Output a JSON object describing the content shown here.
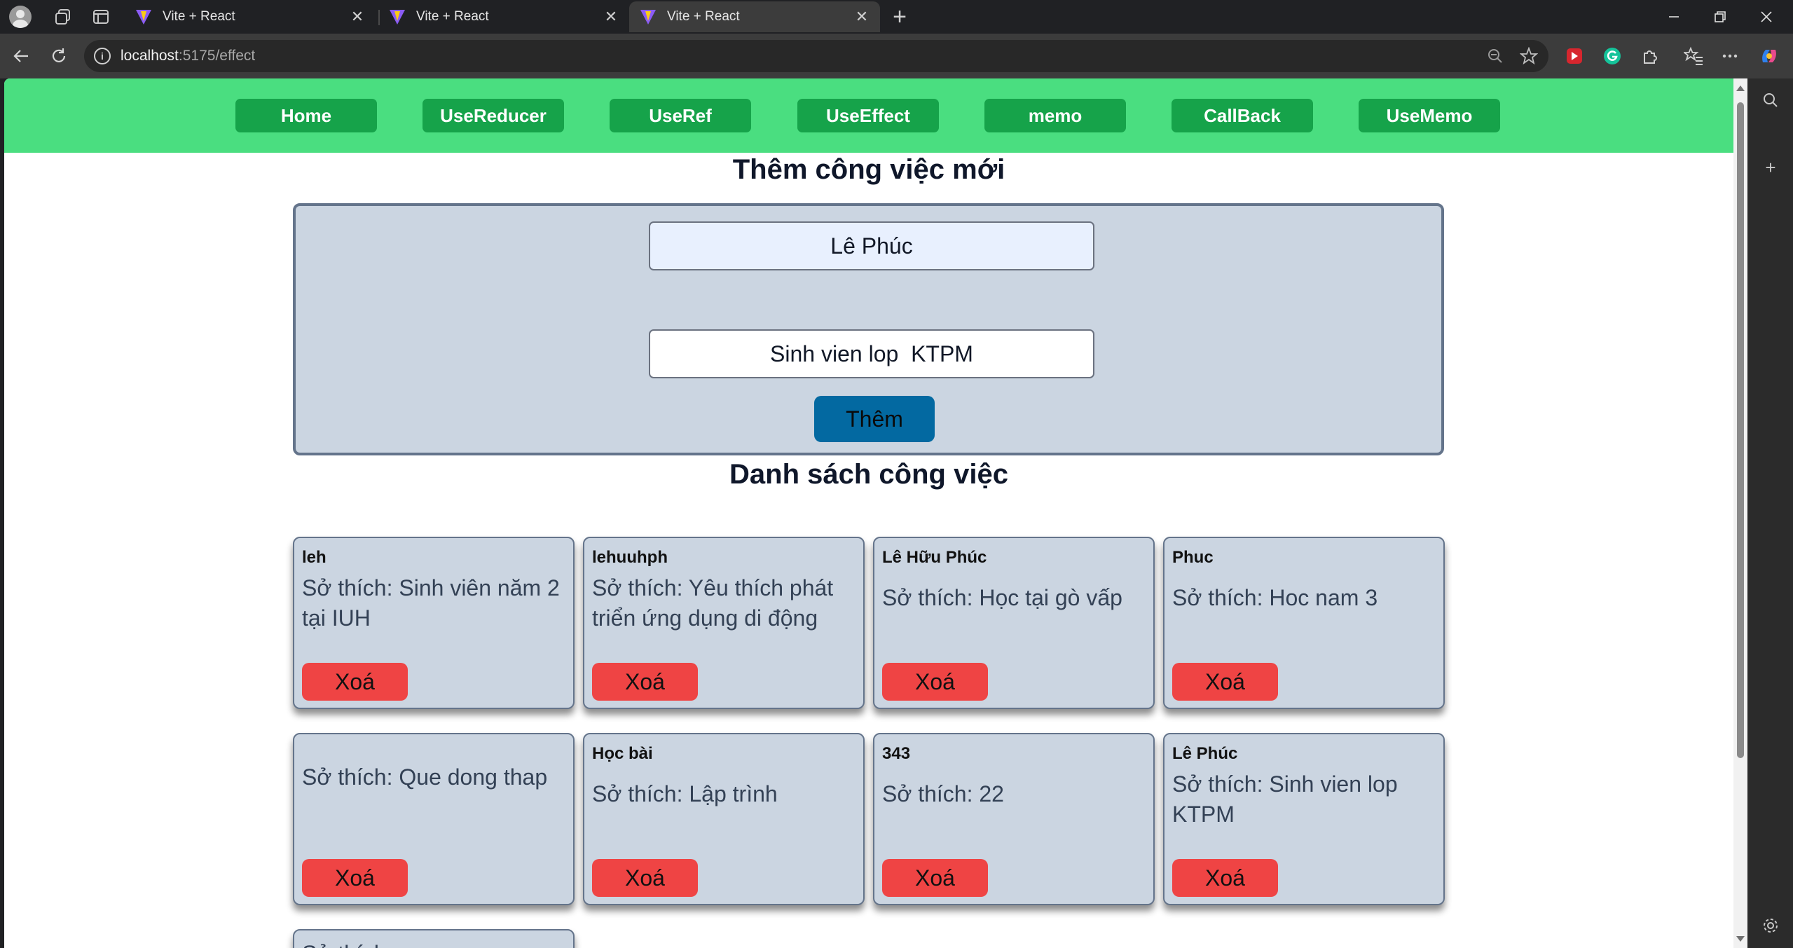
{
  "browser": {
    "tabs": [
      {
        "title": "Vite + React",
        "active": false
      },
      {
        "title": "Vite + React",
        "active": false
      },
      {
        "title": "Vite + React",
        "active": true
      }
    ],
    "url_host": "localhost",
    "url_path": ":5175/effect"
  },
  "nav": {
    "links": [
      "Home",
      "UseReducer",
      "UseRef",
      "UseEffect",
      "memo",
      "CallBack",
      "UseMemo"
    ]
  },
  "form": {
    "title": "Thêm công việc mới",
    "name_value": "Lê Phúc",
    "desc_value": "Sinh vien lop  KTPM",
    "add_label": "Thêm"
  },
  "list": {
    "title": "Danh sách công việc",
    "delete_label": "Xoá",
    "cards": [
      {
        "name": "leh",
        "desc": "Sở thích: Sinh viên năm 2 tại IUH"
      },
      {
        "name": "lehuuhph",
        "desc": "Sở thích: Yêu thích phát triển ứng dụng di động"
      },
      {
        "name": "Lê Hữu Phúc",
        "desc": "Sở thích: Học tại gò vấp"
      },
      {
        "name": "Phuc",
        "desc": "Sở thích: Hoc nam 3"
      },
      {
        "name": "",
        "desc": "Sở thích: Que dong thap"
      },
      {
        "name": "Học bài",
        "desc": "Sở thích: Lập trình"
      },
      {
        "name": "343",
        "desc": "Sở thích: 22"
      },
      {
        "name": "Lê Phúc",
        "desc": "Sở thích: Sinh vien lop KTPM"
      },
      {
        "name": "",
        "desc": "Sở thích:"
      }
    ]
  },
  "colors": {
    "navbar": "#4ade80",
    "nav_button": "#16a34a",
    "card_bg": "#cbd5e1",
    "delete_button": "#ef4444",
    "add_button": "#0369a1"
  }
}
